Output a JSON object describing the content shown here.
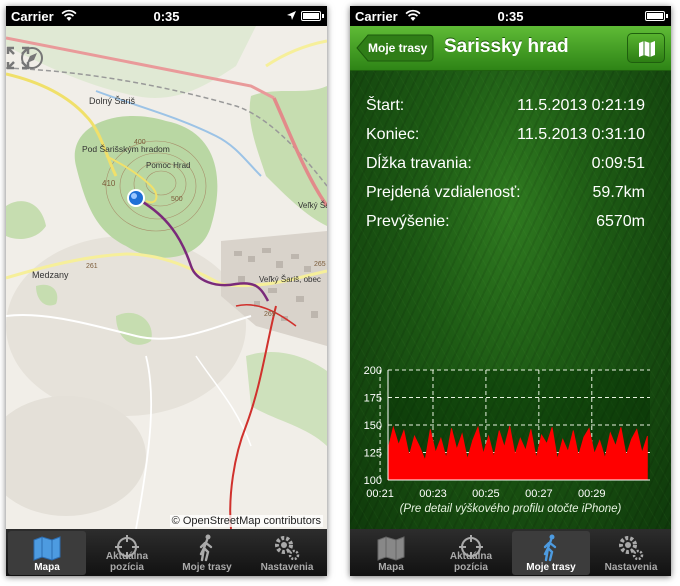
{
  "status_bar_left": {
    "carrier": "Carrier",
    "time": "0:35"
  },
  "status_bar_right": {
    "carrier": "Carrier",
    "time": "0:35"
  },
  "map": {
    "attribution": "© OpenStreetMap contributors",
    "labels": [
      "Dolný Šariš",
      "Pod Šarišským hradom",
      "Pomoc Hrad",
      "410",
      "400",
      "500",
      "Veľký Šariš",
      "Veľký Šariš, obec",
      "Medzany",
      "269",
      "265",
      "261"
    ]
  },
  "nav": {
    "back_label": "Moje trasy",
    "title": "Sarissky hrad"
  },
  "stats": [
    {
      "label": "Štart:",
      "value": "11.5.2013 0:21:19"
    },
    {
      "label": "Koniec:",
      "value": "11.5.2013 0:31:10"
    },
    {
      "label": "Dĺžka travania:",
      "value": "0:09:51"
    },
    {
      "label": "Prejdená vzdialenosť:",
      "value": "59.7km"
    },
    {
      "label": "Prevýšenie:",
      "value": "6570m"
    }
  ],
  "chart_data": {
    "type": "area",
    "y_ticks": [
      "200",
      "175",
      "150",
      "125",
      "100"
    ],
    "x_ticks": [
      "00:21",
      "00:23",
      "00:25",
      "00:27",
      "00:29"
    ],
    "ylim": [
      100,
      200
    ],
    "x_range_minutes": [
      21.3,
      31.2
    ],
    "series": [
      {
        "color": "#ff0000",
        "x": [
          21.3,
          21.5,
          21.7,
          21.9,
          22.1,
          22.3,
          22.5,
          22.7,
          22.9,
          23.1,
          23.3,
          23.5,
          23.7,
          23.9,
          24.1,
          24.3,
          24.5,
          24.7,
          24.9,
          25.1,
          25.3,
          25.5,
          25.7,
          25.9,
          26.1,
          26.3,
          26.5,
          26.7,
          26.9,
          27.1,
          27.3,
          27.5,
          27.7,
          27.9,
          28.1,
          28.3,
          28.5,
          28.7,
          28.9,
          29.1,
          29.3,
          29.5,
          29.7,
          29.9,
          30.1,
          30.3,
          30.5,
          30.7,
          30.9,
          31.1
        ],
        "values": [
          128,
          148,
          132,
          145,
          122,
          140,
          130,
          118,
          146,
          125,
          138,
          120,
          147,
          128,
          142,
          119,
          136,
          148,
          124,
          140,
          121,
          145,
          130,
          149,
          123,
          138,
          127,
          146,
          120,
          141,
          133,
          148,
          119,
          137,
          126,
          145,
          122,
          139,
          147,
          124,
          136,
          120,
          143,
          131,
          148,
          122,
          137,
          146,
          125,
          140
        ]
      }
    ],
    "grid": true
  },
  "chart_note": "(Pre detail výškového profilu otočte iPhone)",
  "tabs_left": [
    {
      "label": "Mapa",
      "icon": "map-icon",
      "active": true
    },
    {
      "label": "Aktuálna pozícia",
      "icon": "crosshair-icon",
      "active": false
    },
    {
      "label": "Moje trasy",
      "icon": "walker-icon",
      "active": false
    },
    {
      "label": "Nastavenia",
      "icon": "gear-icon",
      "active": false
    }
  ],
  "tabs_right": [
    {
      "label": "Mapa",
      "icon": "map-icon",
      "active": false
    },
    {
      "label": "Aktuálna pozícia",
      "icon": "crosshair-icon",
      "active": false
    },
    {
      "label": "Moje trasy",
      "icon": "walker-icon",
      "active": true
    },
    {
      "label": "Nastavenia",
      "icon": "gear-icon",
      "active": false
    }
  ],
  "colors": {
    "nav_green": "#3f9d22",
    "route_purple": "#7a2a7a",
    "route_red": "#d0312d",
    "chart_fill": "#ff0000"
  }
}
